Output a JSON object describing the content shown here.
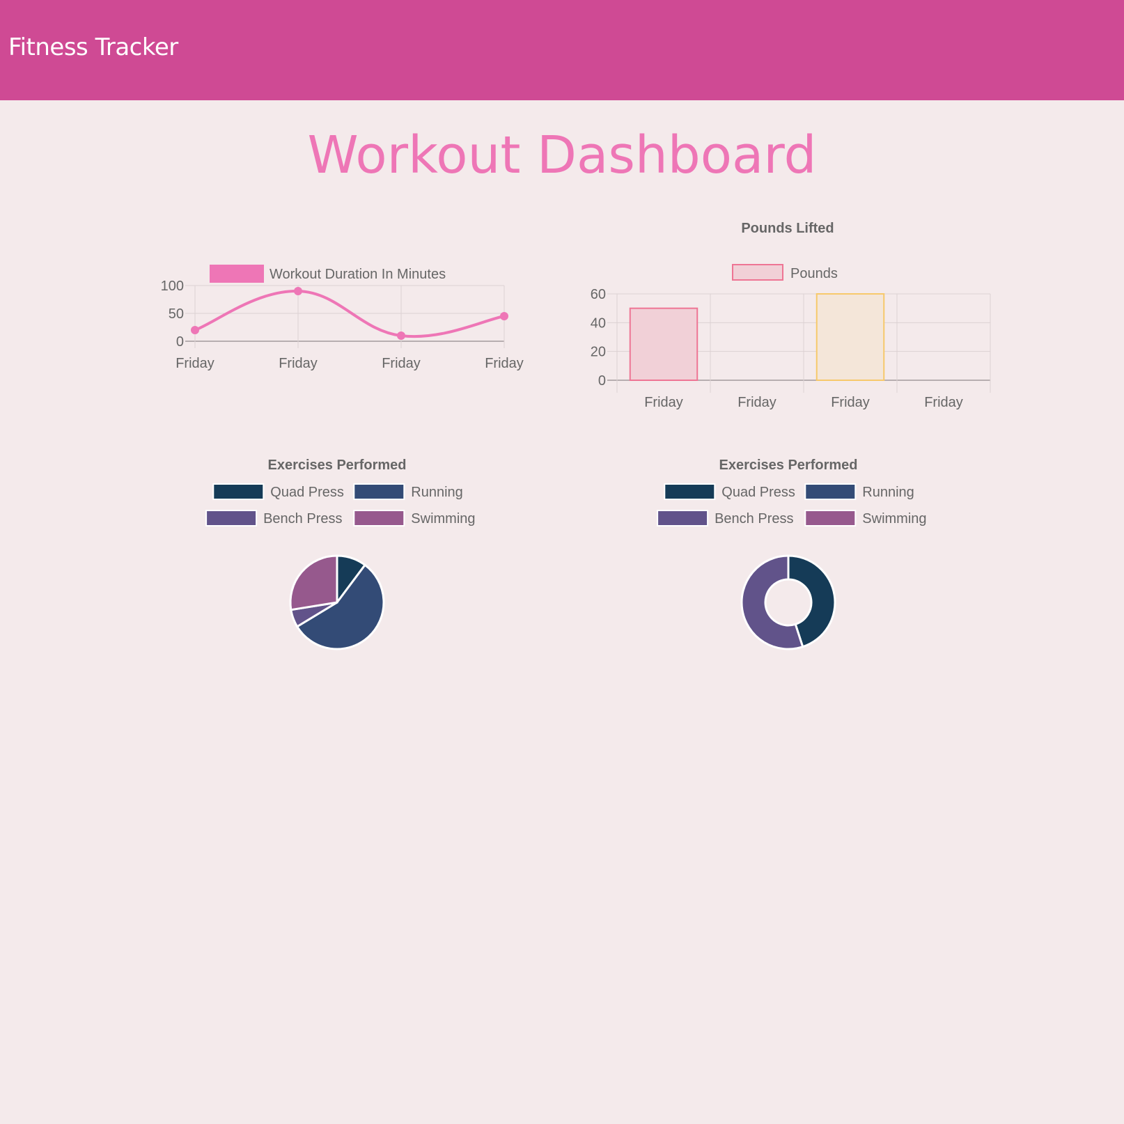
{
  "app": {
    "brand": "Fitness Tracker",
    "page_title": "Workout Dashboard"
  },
  "colors": {
    "navbar": "#cf4a94",
    "background": "#f4eaeb",
    "title": "#ee76b6",
    "line": "#ee76b6",
    "grid": "#dcd1d3",
    "axis_text": "#666666"
  },
  "chart_data": [
    {
      "type": "line",
      "title": "",
      "categories": [
        "Friday",
        "Friday",
        "Friday",
        "Friday"
      ],
      "series": [
        {
          "name": "Workout Duration In Minutes",
          "values": [
            20,
            90,
            10,
            45
          ],
          "color": "#ee76b6"
        }
      ],
      "y_ticks": [
        0,
        50,
        100
      ],
      "ylim": [
        0,
        100
      ],
      "smooth": true,
      "legend": "top",
      "grid": true
    },
    {
      "type": "bar",
      "title": "Pounds Lifted",
      "categories": [
        "Friday",
        "Friday",
        "Friday",
        "Friday"
      ],
      "series": [
        {
          "name": "Pounds",
          "values": [
            50,
            0,
            60,
            0
          ]
        }
      ],
      "bar_fills": [
        "#f1d0d7",
        "#f4e6d9",
        "#f4e6d9",
        "#f4e6d9"
      ],
      "bar_borders": [
        "#ee7594",
        "#f7c96b",
        "#f7c96b",
        "#f7c96b"
      ],
      "legend_fill": "#f1d0d7",
      "legend_border": "#ee7594",
      "y_ticks": [
        0,
        20,
        40,
        60
      ],
      "ylim": [
        0,
        60
      ],
      "legend": "top",
      "grid": true
    },
    {
      "type": "pie",
      "title": "Exercises Performed",
      "labels": [
        "Quad Press",
        "Running",
        "Bench Press",
        "Swimming"
      ],
      "values": [
        10,
        55,
        6,
        27
      ],
      "colors": [
        "#153b57",
        "#334b76",
        "#61538a",
        "#96598d"
      ],
      "legend": "top"
    },
    {
      "type": "doughnut",
      "title": "Exercises Performed",
      "labels": [
        "Quad Press",
        "Running",
        "Bench Press",
        "Swimming"
      ],
      "values": [
        45,
        0,
        55,
        0
      ],
      "colors": [
        "#153b57",
        "#334b76",
        "#61538a",
        "#96598d"
      ],
      "legend": "top"
    }
  ]
}
